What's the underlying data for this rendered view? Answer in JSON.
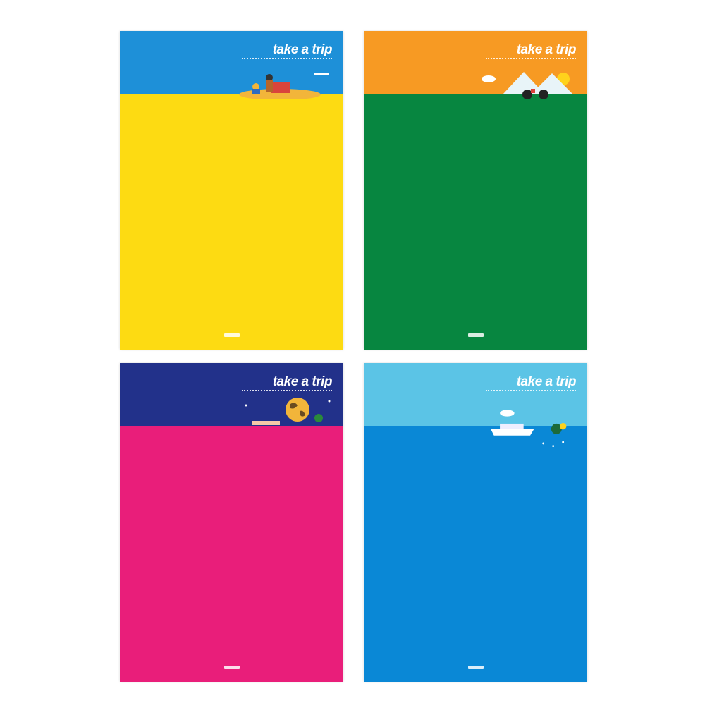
{
  "notebooks": [
    {
      "title": "take a trip",
      "band_color": "#1e90d8",
      "body_color": "#fddb12",
      "illustration": "beach-island-icon"
    },
    {
      "title": "take a trip",
      "band_color": "#f79a23",
      "body_color": "#078640",
      "illustration": "mountain-bicycle-icon"
    },
    {
      "title": "take a trip",
      "band_color": "#22318a",
      "body_color": "#e91e7a",
      "illustration": "globe-icon"
    },
    {
      "title": "take a trip",
      "band_color": "#5bc4e6",
      "body_color": "#0a88d6",
      "illustration": "cruise-ship-icon"
    }
  ]
}
